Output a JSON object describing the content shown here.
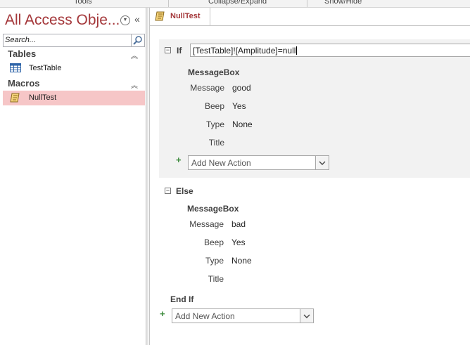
{
  "ribbon": {
    "groups": [
      "Tools",
      "Collapse/Expand",
      "Show/Hide"
    ]
  },
  "nav": {
    "title": "All Access Obje...",
    "search_placeholder": "Search...",
    "groups": [
      {
        "label": "Tables",
        "items": [
          {
            "label": "TestTable",
            "icon": "table-icon"
          }
        ]
      },
      {
        "label": "Macros",
        "items": [
          {
            "label": "NullTest",
            "icon": "macro-icon",
            "selected": true
          }
        ]
      }
    ]
  },
  "document": {
    "tab_label": "NullTest",
    "if_keyword": "If",
    "condition": "[TestTable]![Amplitude]=null",
    "if_action": {
      "name": "MessageBox",
      "args": [
        {
          "label": "Message",
          "value": "good"
        },
        {
          "label": "Beep",
          "value": "Yes"
        },
        {
          "label": "Type",
          "value": "None"
        },
        {
          "label": "Title",
          "value": ""
        }
      ]
    },
    "if_add_action": "Add New Action",
    "else_keyword": "Else",
    "else_action": {
      "name": "MessageBox",
      "args": [
        {
          "label": "Message",
          "value": "bad"
        },
        {
          "label": "Beep",
          "value": "Yes"
        },
        {
          "label": "Type",
          "value": "None"
        },
        {
          "label": "Title",
          "value": ""
        }
      ]
    },
    "end_if_keyword": "End If",
    "bottom_add_action": "Add New Action"
  },
  "colors": {
    "accent": "#a4373a",
    "selected_bg": "#f6c6c7",
    "block_bg": "#f2f2f2",
    "plus": "#3b8a3b"
  }
}
